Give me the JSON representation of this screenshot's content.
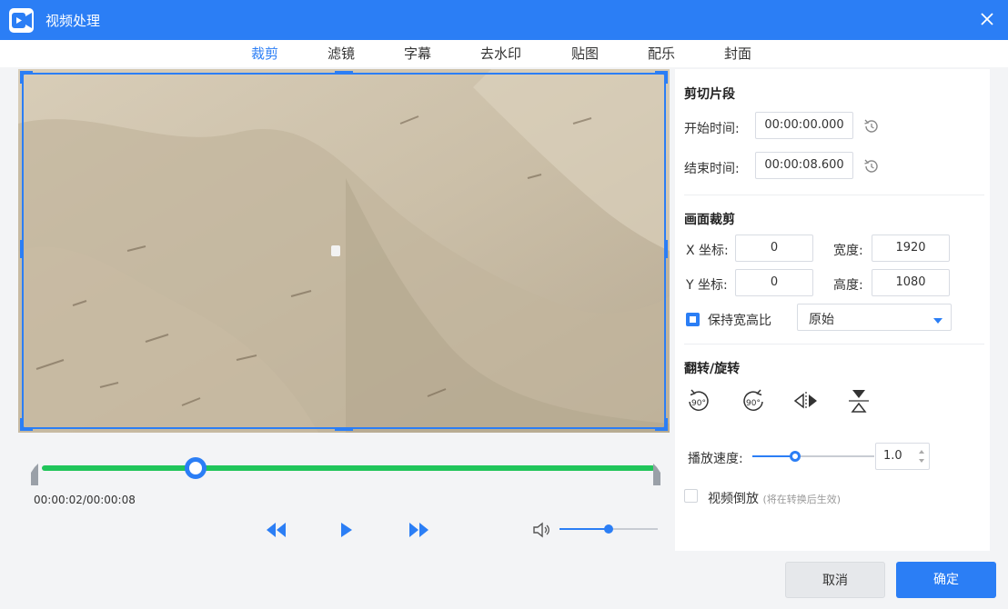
{
  "window": {
    "title": "视频处理"
  },
  "tabs": [
    {
      "label": "裁剪",
      "active": true
    },
    {
      "label": "滤镜",
      "active": false
    },
    {
      "label": "字幕",
      "active": false
    },
    {
      "label": "去水印",
      "active": false
    },
    {
      "label": "贴图",
      "active": false
    },
    {
      "label": "配乐",
      "active": false
    },
    {
      "label": "封面",
      "active": false
    }
  ],
  "player": {
    "current_time": "00:00:02",
    "total_time": "00:00:08",
    "time_separator": "/",
    "progress_fraction": 0.25,
    "volume_fraction": 0.5
  },
  "trim": {
    "section_title": "剪切片段",
    "start_label": "开始时间:",
    "start_value": "00:00:00.000",
    "end_label": "结束时间:",
    "end_value": "00:00:08.600"
  },
  "crop": {
    "section_title": "画面裁剪",
    "x_label": "X 坐标:",
    "x_value": "0",
    "y_label": "Y 坐标:",
    "y_value": "0",
    "width_label": "宽度:",
    "width_value": "1920",
    "height_label": "高度:",
    "height_value": "1080",
    "keep_ratio_label": "保持宽高比",
    "keep_ratio_checked": true,
    "ratio_value": "原始"
  },
  "transform": {
    "section_title": "翻转/旋转",
    "rotate_cw_text": "90°",
    "rotate_ccw_text": "90°"
  },
  "speed": {
    "label": "播放速度:",
    "value": "1.0",
    "fraction": 0.35
  },
  "reverse": {
    "label": "视频倒放",
    "hint": "(将在转换后生效)",
    "checked": false
  },
  "footer": {
    "cancel_label": "取消",
    "ok_label": "确定"
  },
  "colors": {
    "accent": "#2b7ef5",
    "progress": "#20c55a"
  }
}
